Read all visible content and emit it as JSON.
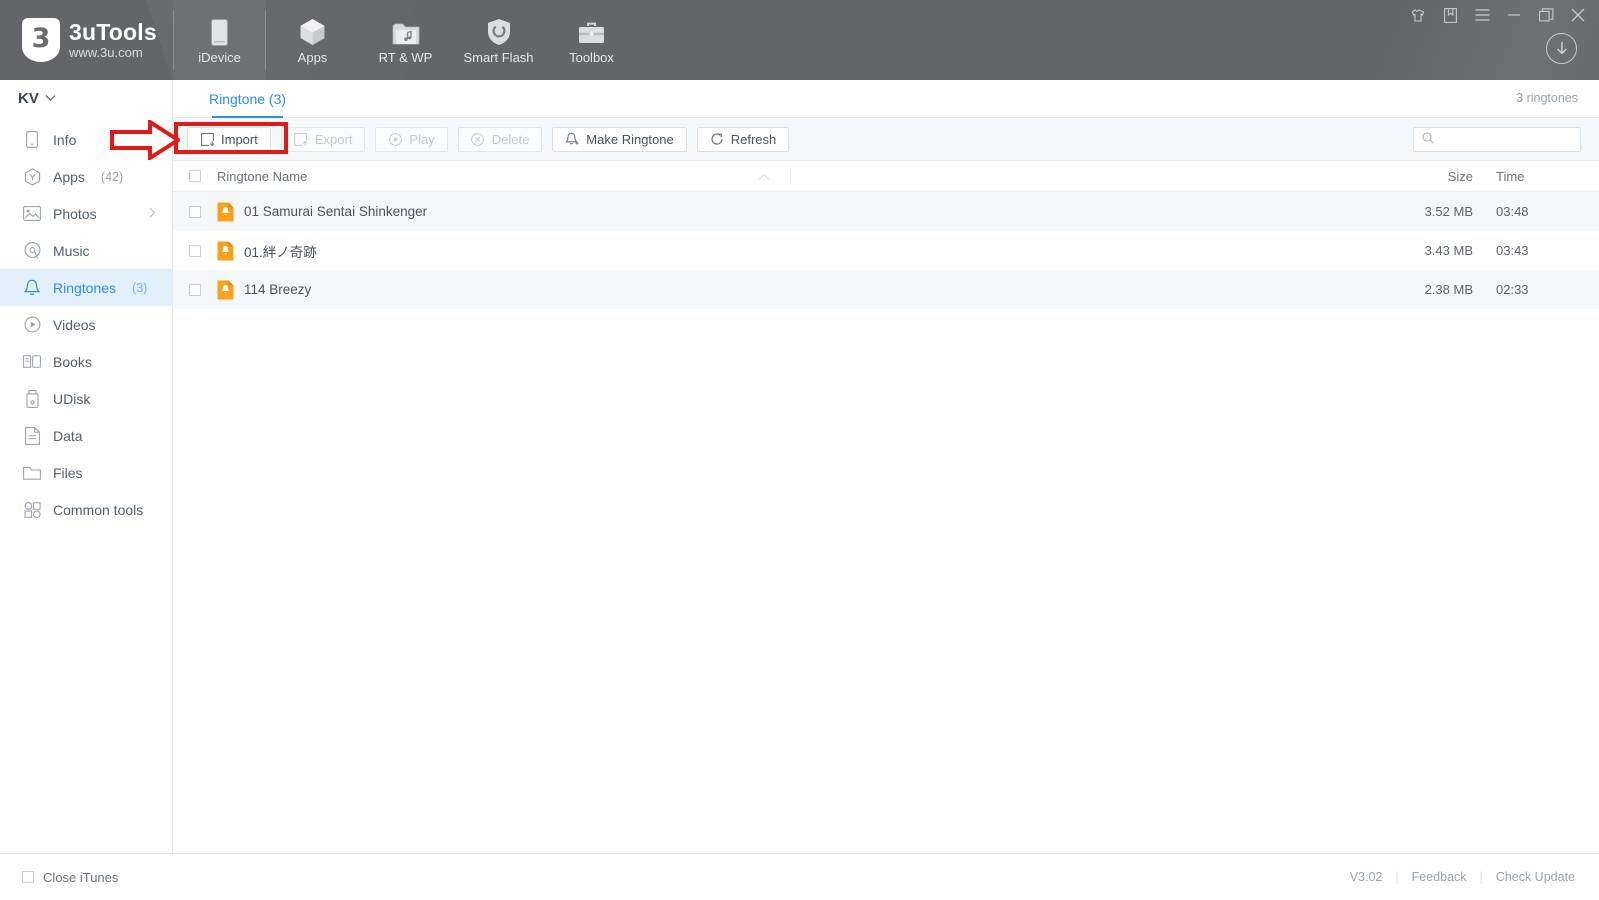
{
  "app": {
    "brand_name": "3uTools",
    "brand_url": "www.3u.com",
    "brand_mark": "3"
  },
  "topnav": {
    "tabs": [
      {
        "label": "iDevice",
        "icon": "phone-icon",
        "active": true
      },
      {
        "label": "Apps",
        "icon": "cube-icon",
        "active": false
      },
      {
        "label": "RT & WP",
        "icon": "music-folder-icon",
        "active": false
      },
      {
        "label": "Smart Flash",
        "icon": "shield-refresh-icon",
        "active": false
      },
      {
        "label": "Toolbox",
        "icon": "toolbox-icon",
        "active": false
      }
    ],
    "window_buttons": [
      {
        "name": "skin-icon",
        "glyph": "skin"
      },
      {
        "name": "note-icon",
        "glyph": "note"
      },
      {
        "name": "menu-icon",
        "glyph": "menu"
      },
      {
        "name": "minimize-icon",
        "glyph": "minimize"
      },
      {
        "name": "maximize-icon",
        "glyph": "maximize"
      },
      {
        "name": "close-icon",
        "glyph": "close"
      }
    ],
    "download_button": "download-icon"
  },
  "sidebar": {
    "device_name": "KV",
    "items": [
      {
        "label": "Info",
        "count": "",
        "icon": "phone-outline-icon",
        "active": false,
        "chevron": false
      },
      {
        "label": "Apps",
        "count": "(42)",
        "icon": "hexagon-icon",
        "active": false,
        "chevron": false
      },
      {
        "label": "Photos",
        "count": "",
        "icon": "image-icon",
        "active": false,
        "chevron": true
      },
      {
        "label": "Music",
        "count": "",
        "icon": "disc-icon",
        "active": false,
        "chevron": false
      },
      {
        "label": "Ringtones",
        "count": "(3)",
        "icon": "bell-icon",
        "active": true,
        "chevron": false
      },
      {
        "label": "Videos",
        "count": "",
        "icon": "play-circle-icon",
        "active": false,
        "chevron": false
      },
      {
        "label": "Books",
        "count": "",
        "icon": "book-icon",
        "active": false,
        "chevron": false
      },
      {
        "label": "UDisk",
        "count": "",
        "icon": "usb-icon",
        "active": false,
        "chevron": false
      },
      {
        "label": "Data",
        "count": "",
        "icon": "document-icon",
        "active": false,
        "chevron": false
      },
      {
        "label": "Files",
        "count": "",
        "icon": "folder-icon",
        "active": false,
        "chevron": false
      },
      {
        "label": "Common tools",
        "count": "",
        "icon": "grid-tools-icon",
        "active": false,
        "chevron": false
      }
    ]
  },
  "content": {
    "tab_label": "Ringtone (3)",
    "ringtone_count_label": "3 ringtones",
    "toolbar": {
      "import_label": "Import",
      "export_label": "Export",
      "play_label": "Play",
      "delete_label": "Delete",
      "make_ringtone_label": "Make Ringtone",
      "refresh_label": "Refresh"
    },
    "search": {
      "value": "",
      "placeholder": ""
    },
    "table": {
      "columns": {
        "name": "Ringtone Name",
        "size": "Size",
        "time": "Time"
      },
      "rows": [
        {
          "name": "01 Samurai Sentai Shinkenger",
          "size": "3.52 MB",
          "time": "03:48"
        },
        {
          "name": "01.絆ノ奇跡",
          "size": "3.43 MB",
          "time": "03:43"
        },
        {
          "name": "114 Breezy",
          "size": "2.38 MB",
          "time": "02:33"
        }
      ]
    }
  },
  "footer": {
    "close_itunes_label": "Close iTunes",
    "version": "V3.02",
    "separator": "|",
    "feedback_label": "Feedback",
    "check_update_label": "Check Update"
  },
  "annotation": {
    "highlight_target": "import-button",
    "arrow_color": "#e01b16",
    "box_color": "#e01b16"
  },
  "colors": {
    "header_bg": "#636569",
    "accent_blue": "#2f8fe0",
    "active_sidebar_bg": "#e2f0fb",
    "row_alt_bg": "#f4f8fb",
    "file_icon_orange": "#f5a623"
  }
}
